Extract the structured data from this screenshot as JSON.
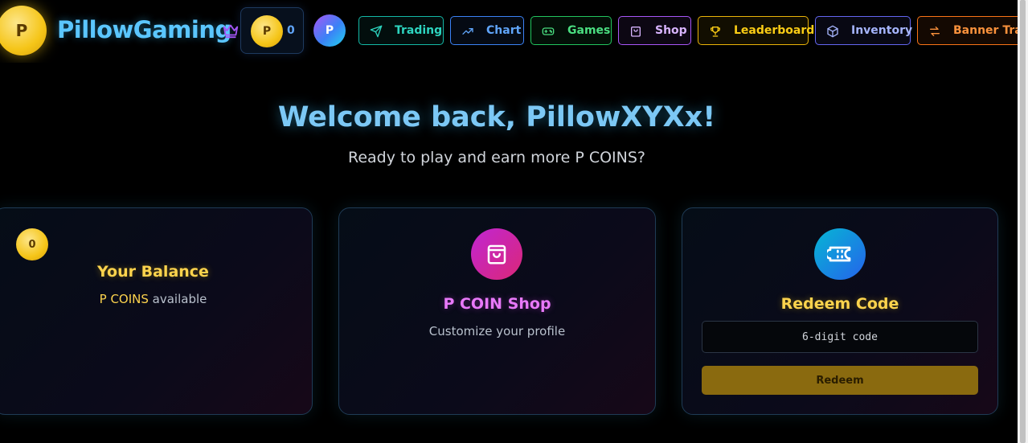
{
  "header": {
    "logo_letter": "P",
    "brand": "PillowGaming",
    "balance": {
      "coin_letter": "P",
      "amount": "0"
    },
    "avatar_letter": "P",
    "nav": [
      {
        "label": "Trading",
        "icon": "send-icon",
        "color": "#2dd4bf"
      },
      {
        "label": "Chart",
        "icon": "trending-up-icon",
        "color": "#60a5fa"
      },
      {
        "label": "Games",
        "icon": "gamepad-icon",
        "color": "#4ade80"
      },
      {
        "label": "Shop",
        "icon": "shopping-bag-icon",
        "color": "#d8b4fe"
      },
      {
        "label": "Leaderboard",
        "icon": "trophy-icon",
        "color": "#facc15"
      },
      {
        "label": "Inventory",
        "icon": "box-icon",
        "color": "#a5b4fc"
      },
      {
        "label": "Banner Tradi",
        "icon": "swap-icon",
        "color": "#fb923c"
      }
    ]
  },
  "hero": {
    "title": "Welcome back, PillowXYXx!",
    "subtitle": "Ready to play and earn more P COINS?"
  },
  "cards": {
    "balance": {
      "coin_value": "0",
      "title": "Your Balance",
      "currency": "P COINS",
      "suffix": " available"
    },
    "shop": {
      "title": "P COIN Shop",
      "text": "Customize your profile"
    },
    "redeem": {
      "title": "Redeem Code",
      "placeholder": "6-digit code",
      "button": "Redeem"
    }
  },
  "colors": {
    "accent_blue": "#5bc6ff",
    "gold": "#fcd34d",
    "pink": "#e879f9"
  }
}
